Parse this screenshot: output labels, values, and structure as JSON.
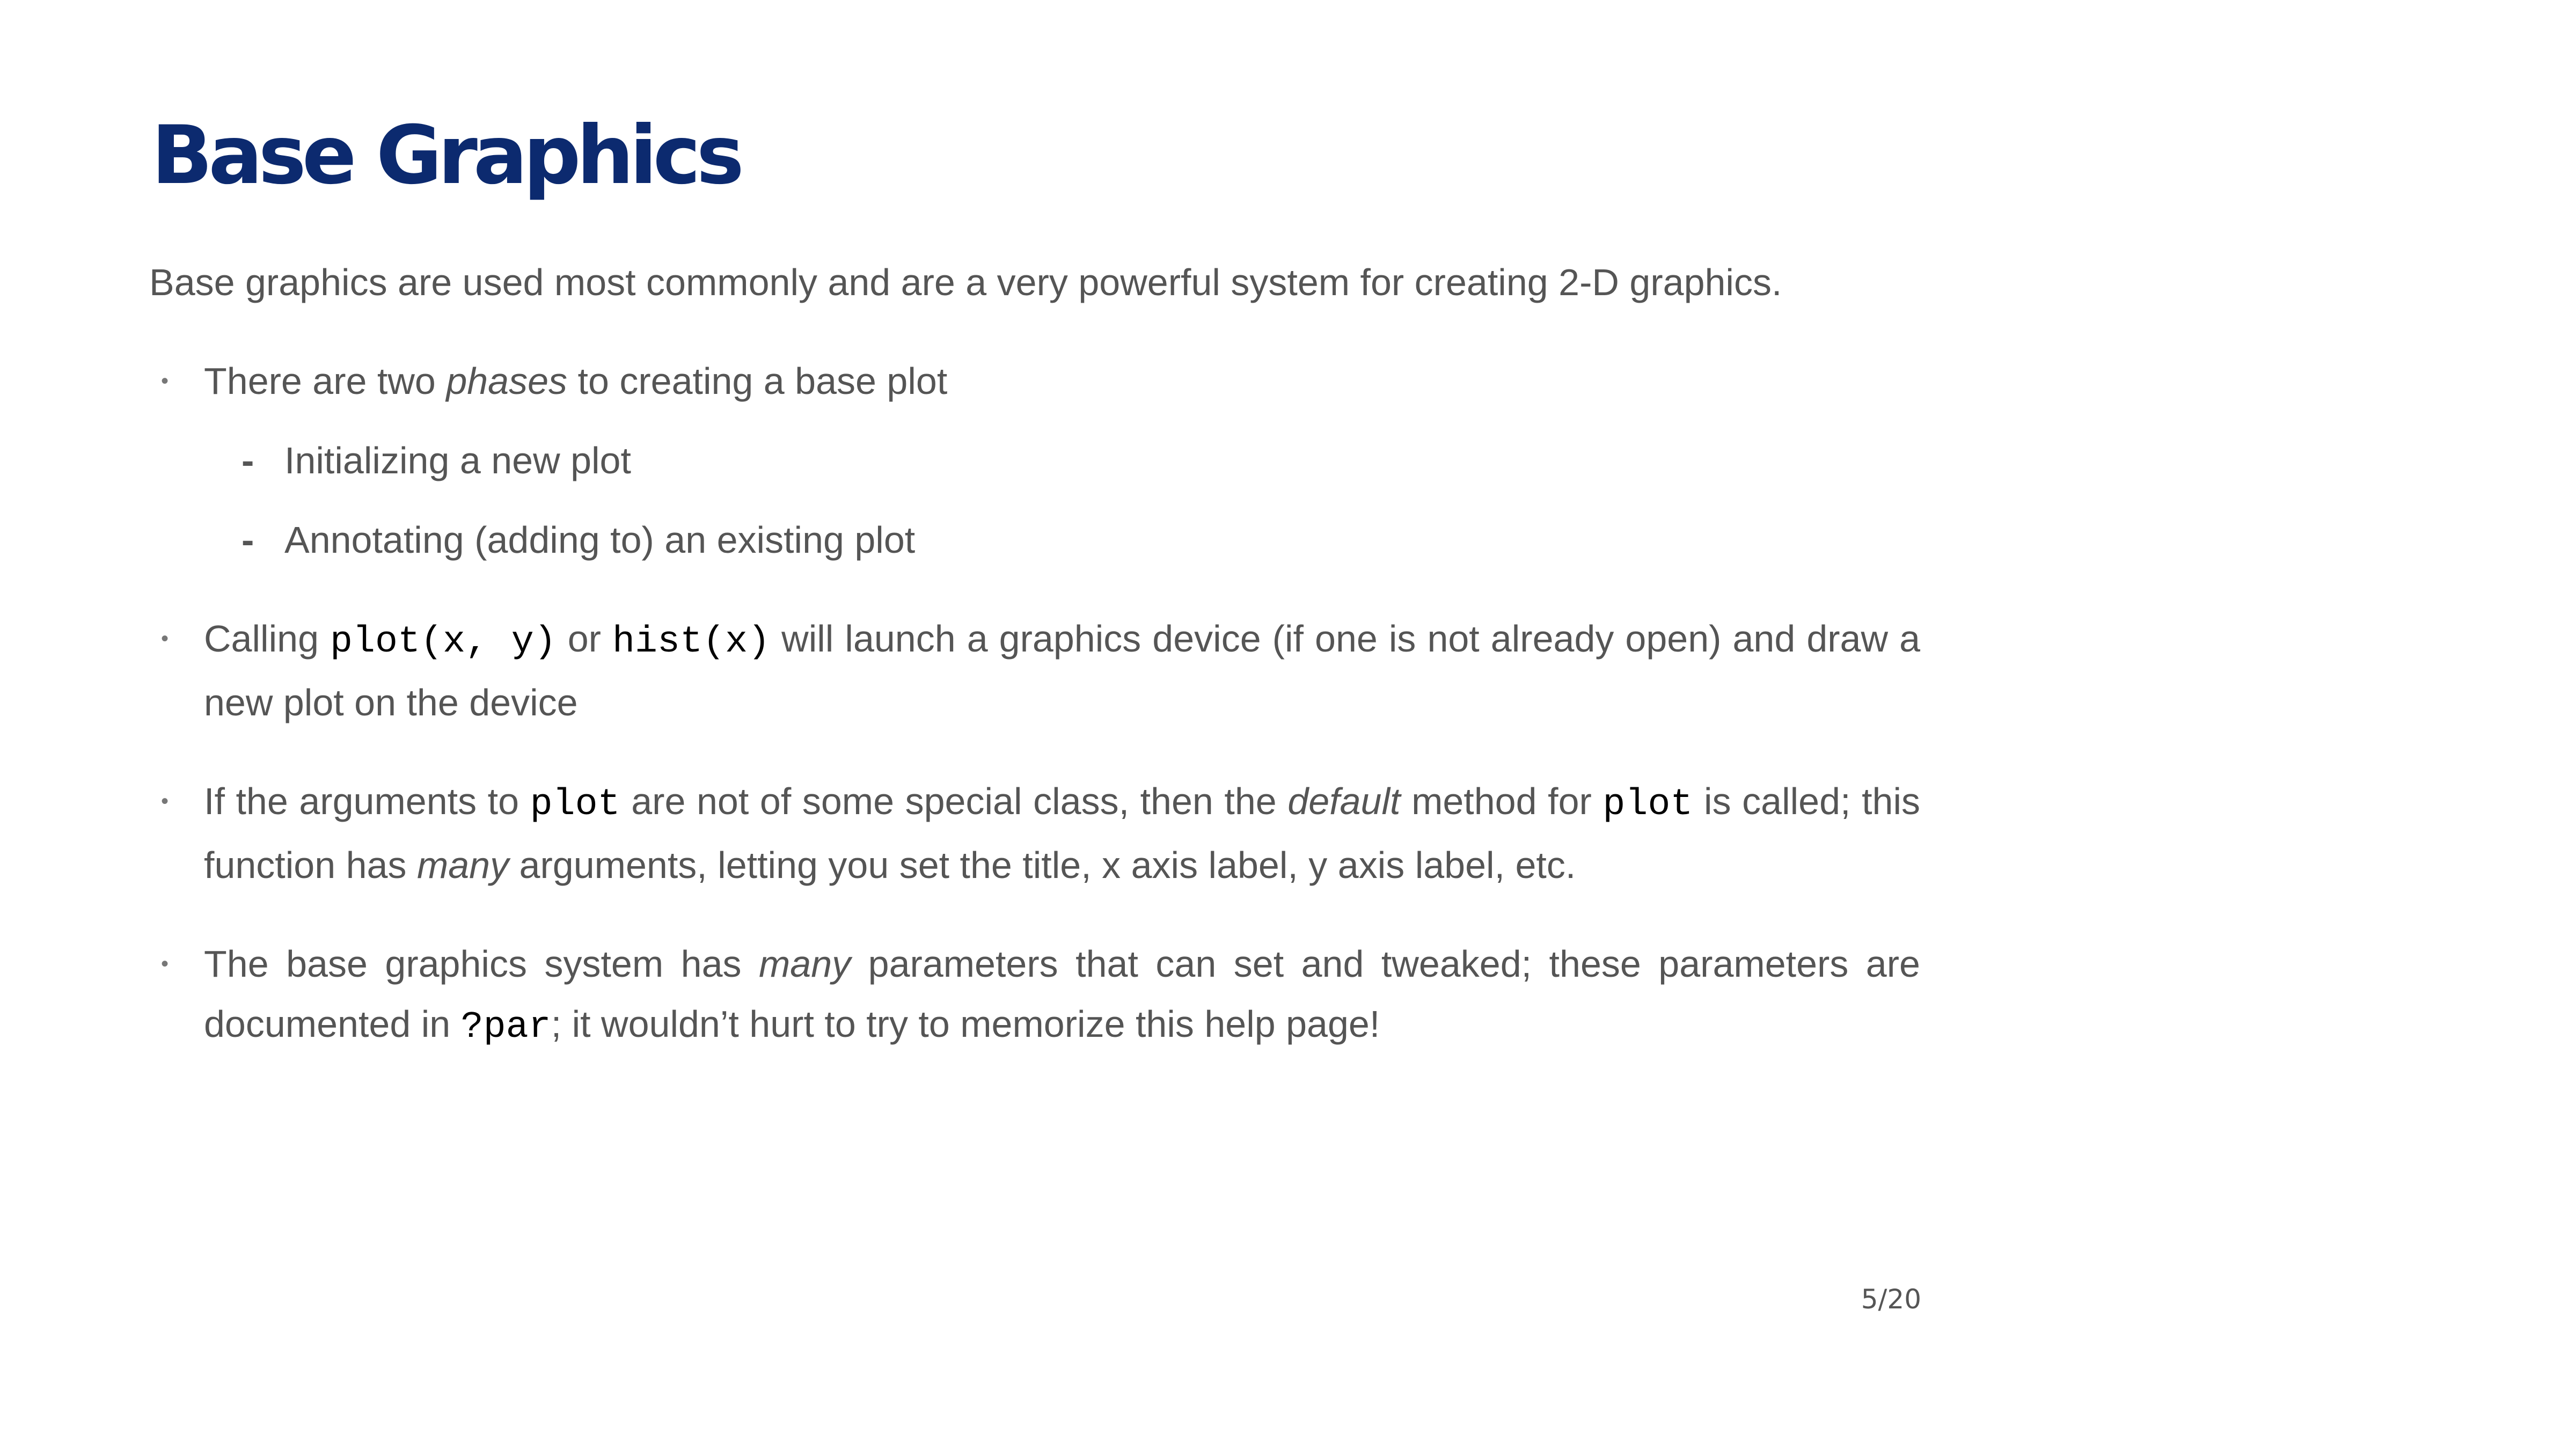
{
  "slide": {
    "title": "Base Graphics",
    "intro": "Base graphics are used most commonly and are a very powerful system for creating 2-D graphics.",
    "page_number": "5/20"
  },
  "bullets": {
    "b1": {
      "t1": "There are two ",
      "em1": "phases",
      "t2": " to creating a base plot",
      "sub1": "Initializing a new plot",
      "sub2": "Annotating (adding to) an existing plot"
    },
    "b2": {
      "t1": "Calling ",
      "code1": "plot(x, y)",
      "t2": " or ",
      "code2": "hist(x)",
      "t3": " will launch a graphics device (if one is not already open) and draw a new plot on the device"
    },
    "b3": {
      "t1": "If the arguments to ",
      "code1": "plot",
      "t2": " are not of some special class, then the ",
      "em1": "default",
      "t3": " method for ",
      "code2": "plot",
      "t4": " is called; this function has ",
      "em2": "many",
      "t5": " arguments, letting you set the title, x axis label, y axis label, etc."
    },
    "b4": {
      "t1": "The base graphics system has ",
      "em1": "many",
      "t2": " parameters that can set and tweaked; these parameters are documented in ",
      "code1": "?par",
      "t3": "; it wouldn’t hurt to try to memorize this help page!"
    }
  },
  "markers": {
    "bullet": "•",
    "dash": "-"
  }
}
